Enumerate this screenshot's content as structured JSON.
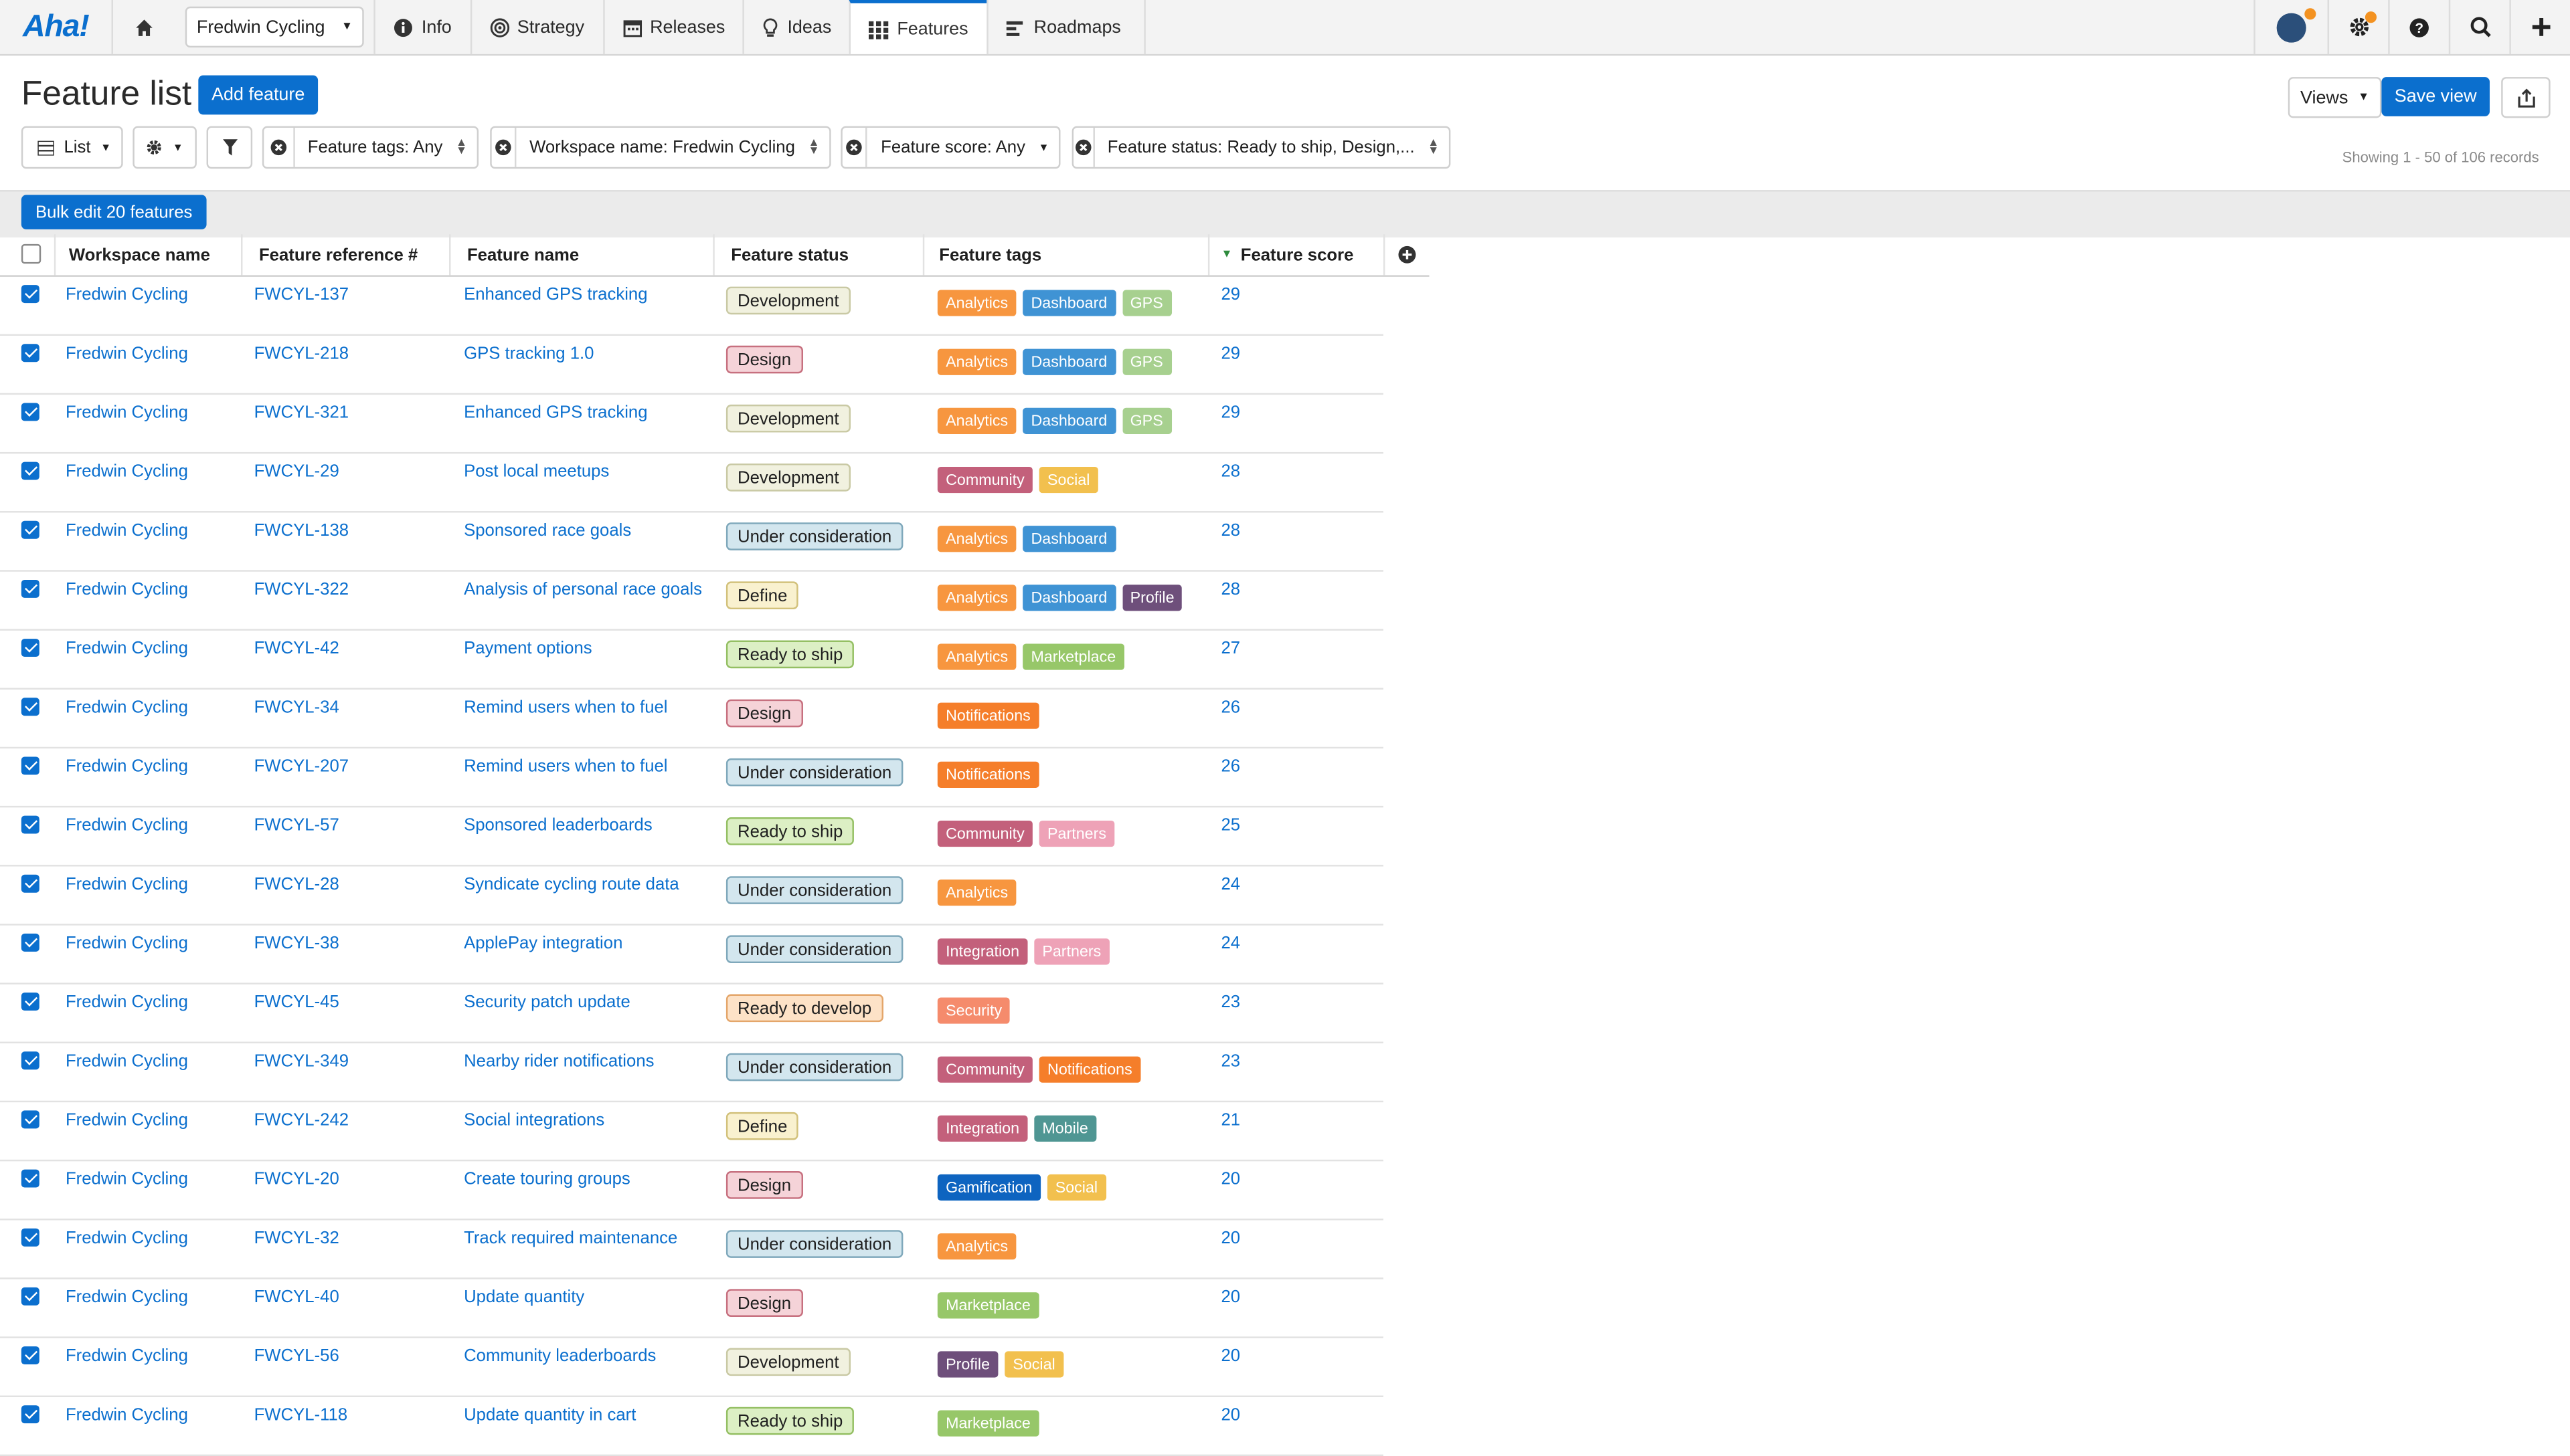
{
  "nav": {
    "logo": "Aha!",
    "workspace": "Fredwin Cycling",
    "items": [
      {
        "label": "Info",
        "icon": "info-icon"
      },
      {
        "label": "Strategy",
        "icon": "target-icon"
      },
      {
        "label": "Releases",
        "icon": "calendar-icon"
      },
      {
        "label": "Ideas",
        "icon": "lightbulb-icon"
      },
      {
        "label": "Features",
        "icon": "grid-icon",
        "active": true
      },
      {
        "label": "Roadmaps",
        "icon": "roadmap-icon"
      }
    ]
  },
  "header": {
    "title": "Feature list",
    "add_feature": "Add feature",
    "views": "Views",
    "save_view": "Save view"
  },
  "filters": {
    "view_mode": "List",
    "tags": "Feature tags: Any",
    "workspace": "Workspace name: Fredwin Cycling",
    "score": "Feature score: Any",
    "status": "Feature status: Ready to ship, Design,..."
  },
  "showing": "Showing 1 - 50 of 106 records",
  "bulk_edit": "Bulk edit 20 features",
  "columns": [
    "Workspace name",
    "Feature reference #",
    "Feature name",
    "Feature status",
    "Feature tags",
    "Feature score"
  ],
  "tag_colors": {
    "Analytics": "#f7963f",
    "Dashboard": "#3f93d4",
    "GPS": "#a7d08f",
    "Community": "#c3607b",
    "Social": "#f2c04e",
    "Profile": "#6e4f7b",
    "Marketplace": "#97c769",
    "Notifications": "#f57e2a",
    "Partners": "#eea2b7",
    "Integration": "#c3607b",
    "Security": "#f58b6c",
    "Mobile": "#4f9693",
    "Gamification": "#0e64c0"
  },
  "status_colors": {
    "Development": {
      "bg": "#f1f1df",
      "border": "#c9c9a4"
    },
    "Design": {
      "bg": "#f5d3d8",
      "border": "#c7707f"
    },
    "Under consideration": {
      "bg": "#d3e6ee",
      "border": "#7fa8bb"
    },
    "Define": {
      "bg": "#f9f1cf",
      "border": "#d2c17b"
    },
    "Ready to ship": {
      "bg": "#dcefc4",
      "border": "#94bf63"
    },
    "Ready to develop": {
      "bg": "#fde2c7",
      "border": "#e4a66a"
    }
  },
  "rows": [
    {
      "workspace": "Fredwin Cycling",
      "ref": "FWCYL-137",
      "name": "Enhanced GPS tracking",
      "status": "Development",
      "tags": [
        "Analytics",
        "Dashboard",
        "GPS"
      ],
      "score": "29"
    },
    {
      "workspace": "Fredwin Cycling",
      "ref": "FWCYL-218",
      "name": "GPS tracking 1.0",
      "status": "Design",
      "tags": [
        "Analytics",
        "Dashboard",
        "GPS"
      ],
      "score": "29"
    },
    {
      "workspace": "Fredwin Cycling",
      "ref": "FWCYL-321",
      "name": "Enhanced GPS tracking",
      "status": "Development",
      "tags": [
        "Analytics",
        "Dashboard",
        "GPS"
      ],
      "score": "29"
    },
    {
      "workspace": "Fredwin Cycling",
      "ref": "FWCYL-29",
      "name": "Post local meetups",
      "status": "Development",
      "tags": [
        "Community",
        "Social"
      ],
      "score": "28"
    },
    {
      "workspace": "Fredwin Cycling",
      "ref": "FWCYL-138",
      "name": "Sponsored race goals",
      "status": "Under consideration",
      "tags": [
        "Analytics",
        "Dashboard"
      ],
      "score": "28"
    },
    {
      "workspace": "Fredwin Cycling",
      "ref": "FWCYL-322",
      "name": "Analysis of personal race goals",
      "status": "Define",
      "tags": [
        "Analytics",
        "Dashboard",
        "Profile"
      ],
      "score": "28"
    },
    {
      "workspace": "Fredwin Cycling",
      "ref": "FWCYL-42",
      "name": "Payment options",
      "status": "Ready to ship",
      "tags": [
        "Analytics",
        "Marketplace"
      ],
      "score": "27"
    },
    {
      "workspace": "Fredwin Cycling",
      "ref": "FWCYL-34",
      "name": "Remind users when to fuel",
      "status": "Design",
      "tags": [
        "Notifications"
      ],
      "score": "26"
    },
    {
      "workspace": "Fredwin Cycling",
      "ref": "FWCYL-207",
      "name": "Remind users when to fuel",
      "status": "Under consideration",
      "tags": [
        "Notifications"
      ],
      "score": "26"
    },
    {
      "workspace": "Fredwin Cycling",
      "ref": "FWCYL-57",
      "name": "Sponsored leaderboards",
      "status": "Ready to ship",
      "tags": [
        "Community",
        "Partners"
      ],
      "score": "25"
    },
    {
      "workspace": "Fredwin Cycling",
      "ref": "FWCYL-28",
      "name": "Syndicate cycling route data",
      "status": "Under consideration",
      "tags": [
        "Analytics"
      ],
      "score": "24"
    },
    {
      "workspace": "Fredwin Cycling",
      "ref": "FWCYL-38",
      "name": "ApplePay integration",
      "status": "Under consideration",
      "tags": [
        "Integration",
        "Partners"
      ],
      "score": "24"
    },
    {
      "workspace": "Fredwin Cycling",
      "ref": "FWCYL-45",
      "name": "Security patch update",
      "status": "Ready to develop",
      "tags": [
        "Security"
      ],
      "score": "23"
    },
    {
      "workspace": "Fredwin Cycling",
      "ref": "FWCYL-349",
      "name": "Nearby rider notifications",
      "status": "Under consideration",
      "tags": [
        "Community",
        "Notifications"
      ],
      "score": "23"
    },
    {
      "workspace": "Fredwin Cycling",
      "ref": "FWCYL-242",
      "name": "Social integrations",
      "status": "Define",
      "tags": [
        "Integration",
        "Mobile"
      ],
      "score": "21"
    },
    {
      "workspace": "Fredwin Cycling",
      "ref": "FWCYL-20",
      "name": "Create touring groups",
      "status": "Design",
      "tags": [
        "Gamification",
        "Social"
      ],
      "score": "20"
    },
    {
      "workspace": "Fredwin Cycling",
      "ref": "FWCYL-32",
      "name": "Track required maintenance",
      "status": "Under consideration",
      "tags": [
        "Analytics"
      ],
      "score": "20"
    },
    {
      "workspace": "Fredwin Cycling",
      "ref": "FWCYL-40",
      "name": "Update quantity",
      "status": "Design",
      "tags": [
        "Marketplace"
      ],
      "score": "20"
    },
    {
      "workspace": "Fredwin Cycling",
      "ref": "FWCYL-56",
      "name": "Community leaderboards",
      "status": "Development",
      "tags": [
        "Profile",
        "Social"
      ],
      "score": "20"
    },
    {
      "workspace": "Fredwin Cycling",
      "ref": "FWCYL-118",
      "name": "Update quantity in cart",
      "status": "Ready to ship",
      "tags": [
        "Marketplace"
      ],
      "score": "20"
    }
  ]
}
